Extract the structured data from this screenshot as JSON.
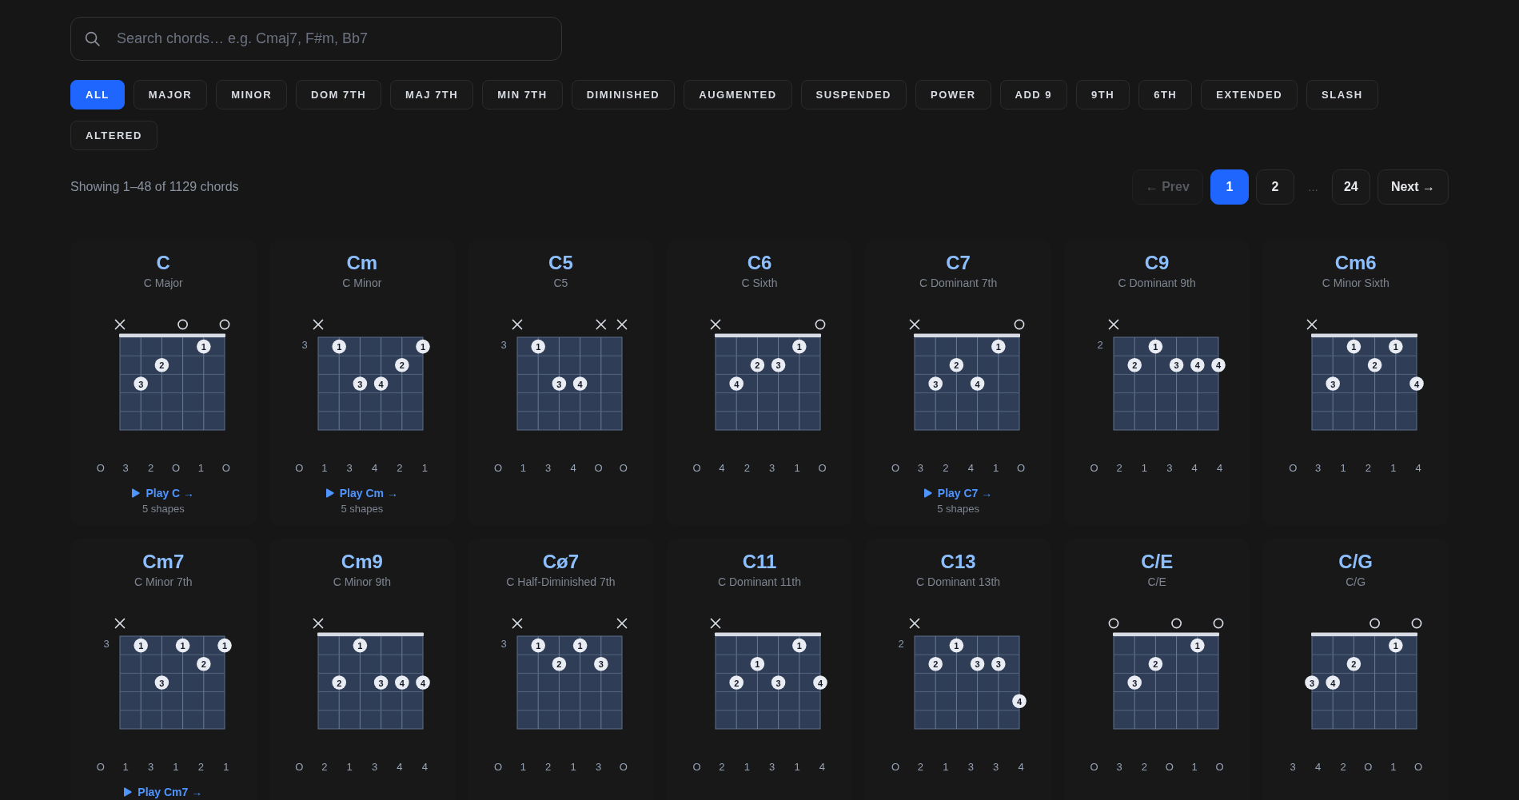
{
  "search": {
    "placeholder": "Search chords… e.g. Cmaj7, F#m, Bb7"
  },
  "filters": [
    {
      "label": "ALL",
      "selected": true
    },
    {
      "label": "MAJOR",
      "selected": false
    },
    {
      "label": "MINOR",
      "selected": false
    },
    {
      "label": "DOM 7TH",
      "selected": false
    },
    {
      "label": "MAJ 7TH",
      "selected": false
    },
    {
      "label": "MIN 7TH",
      "selected": false
    },
    {
      "label": "DIMINISHED",
      "selected": false
    },
    {
      "label": "AUGMENTED",
      "selected": false
    },
    {
      "label": "SUSPENDED",
      "selected": false
    },
    {
      "label": "POWER",
      "selected": false
    },
    {
      "label": "ADD 9",
      "selected": false
    },
    {
      "label": "9TH",
      "selected": false
    },
    {
      "label": "6TH",
      "selected": false
    },
    {
      "label": "EXTENDED",
      "selected": false
    },
    {
      "label": "SLASH",
      "selected": false
    },
    {
      "label": "ALTERED",
      "selected": false
    }
  ],
  "results_summary": "Showing 1–48 of 1129 chords",
  "pagination": {
    "prev": {
      "label": "← Prev",
      "disabled": true
    },
    "pages": [
      {
        "kind": "page",
        "label": "1",
        "selected": true
      },
      {
        "kind": "page",
        "label": "2",
        "selected": false
      },
      {
        "kind": "ellipsis",
        "label": "…",
        "selected": false
      },
      {
        "kind": "page",
        "label": "24",
        "selected": false
      }
    ],
    "next": {
      "label": "Next →",
      "disabled": false
    }
  },
  "chords": [
    {
      "name": "C",
      "full_name": "C Major",
      "markers": [
        {
          "kind": "muted"
        },
        {
          "kind": "none"
        },
        {
          "kind": "none"
        },
        {
          "kind": "open"
        },
        {
          "kind": "none"
        },
        {
          "kind": "open"
        }
      ],
      "nut": true,
      "fret_rows": [
        [
          {
            "kind": "empty"
          },
          {
            "kind": "empty"
          },
          {
            "kind": "empty"
          },
          {
            "kind": "empty"
          },
          {
            "kind": "dot",
            "finger": "1"
          },
          {
            "kind": "empty"
          }
        ],
        [
          {
            "kind": "empty"
          },
          {
            "kind": "empty"
          },
          {
            "kind": "dot",
            "finger": "2"
          },
          {
            "kind": "empty"
          },
          {
            "kind": "empty"
          },
          {
            "kind": "empty"
          }
        ],
        [
          {
            "kind": "empty"
          },
          {
            "kind": "dot",
            "finger": "3"
          },
          {
            "kind": "empty"
          },
          {
            "kind": "empty"
          },
          {
            "kind": "empty"
          },
          {
            "kind": "empty"
          }
        ],
        [
          {
            "kind": "empty"
          },
          {
            "kind": "empty"
          },
          {
            "kind": "empty"
          },
          {
            "kind": "empty"
          },
          {
            "kind": "empty"
          },
          {
            "kind": "empty"
          }
        ],
        [
          {
            "kind": "empty"
          },
          {
            "kind": "empty"
          },
          {
            "kind": "empty"
          },
          {
            "kind": "empty"
          },
          {
            "kind": "empty"
          },
          {
            "kind": "empty"
          }
        ]
      ],
      "fingers": [
        "O",
        "3",
        "2",
        "O",
        "1",
        "O"
      ],
      "play_link": "Play C →",
      "shapes": "5 shapes"
    },
    {
      "name": "Cm",
      "full_name": "C Minor",
      "markers": [
        {
          "kind": "muted"
        },
        {
          "kind": "none"
        },
        {
          "kind": "none"
        },
        {
          "kind": "none"
        },
        {
          "kind": "none"
        },
        {
          "kind": "none"
        }
      ],
      "nut": false,
      "base_fret": "3",
      "fret_rows": [
        [
          {
            "kind": "empty"
          },
          {
            "kind": "dot",
            "finger": "1"
          },
          {
            "kind": "empty"
          },
          {
            "kind": "empty"
          },
          {
            "kind": "empty"
          },
          {
            "kind": "dot",
            "finger": "1"
          }
        ],
        [
          {
            "kind": "empty"
          },
          {
            "kind": "empty"
          },
          {
            "kind": "empty"
          },
          {
            "kind": "empty"
          },
          {
            "kind": "dot",
            "finger": "2"
          },
          {
            "kind": "empty"
          }
        ],
        [
          {
            "kind": "empty"
          },
          {
            "kind": "empty"
          },
          {
            "kind": "dot",
            "finger": "3"
          },
          {
            "kind": "dot",
            "finger": "4"
          },
          {
            "kind": "empty"
          },
          {
            "kind": "empty"
          }
        ],
        [
          {
            "kind": "empty"
          },
          {
            "kind": "empty"
          },
          {
            "kind": "empty"
          },
          {
            "kind": "empty"
          },
          {
            "kind": "empty"
          },
          {
            "kind": "empty"
          }
        ],
        [
          {
            "kind": "empty"
          },
          {
            "kind": "empty"
          },
          {
            "kind": "empty"
          },
          {
            "kind": "empty"
          },
          {
            "kind": "empty"
          },
          {
            "kind": "empty"
          }
        ]
      ],
      "fingers": [
        "O",
        "1",
        "3",
        "4",
        "2",
        "1"
      ],
      "play_link": "Play Cm →",
      "shapes": "5 shapes"
    },
    {
      "name": "C5",
      "full_name": "C5",
      "markers": [
        {
          "kind": "muted"
        },
        {
          "kind": "none"
        },
        {
          "kind": "none"
        },
        {
          "kind": "none"
        },
        {
          "kind": "muted"
        },
        {
          "kind": "muted"
        }
      ],
      "nut": false,
      "base_fret": "3",
      "fret_rows": [
        [
          {
            "kind": "empty"
          },
          {
            "kind": "dot",
            "finger": "1"
          },
          {
            "kind": "empty"
          },
          {
            "kind": "empty"
          },
          {
            "kind": "empty"
          },
          {
            "kind": "empty"
          }
        ],
        [
          {
            "kind": "empty"
          },
          {
            "kind": "empty"
          },
          {
            "kind": "empty"
          },
          {
            "kind": "empty"
          },
          {
            "kind": "empty"
          },
          {
            "kind": "empty"
          }
        ],
        [
          {
            "kind": "empty"
          },
          {
            "kind": "empty"
          },
          {
            "kind": "dot",
            "finger": "3"
          },
          {
            "kind": "dot",
            "finger": "4"
          },
          {
            "kind": "empty"
          },
          {
            "kind": "empty"
          }
        ],
        [
          {
            "kind": "empty"
          },
          {
            "kind": "empty"
          },
          {
            "kind": "empty"
          },
          {
            "kind": "empty"
          },
          {
            "kind": "empty"
          },
          {
            "kind": "empty"
          }
        ],
        [
          {
            "kind": "empty"
          },
          {
            "kind": "empty"
          },
          {
            "kind": "empty"
          },
          {
            "kind": "empty"
          },
          {
            "kind": "empty"
          },
          {
            "kind": "empty"
          }
        ]
      ],
      "fingers": [
        "O",
        "1",
        "3",
        "4",
        "O",
        "O"
      ]
    },
    {
      "name": "C6",
      "full_name": "C Sixth",
      "markers": [
        {
          "kind": "muted"
        },
        {
          "kind": "none"
        },
        {
          "kind": "none"
        },
        {
          "kind": "none"
        },
        {
          "kind": "none"
        },
        {
          "kind": "open"
        }
      ],
      "nut": true,
      "fret_rows": [
        [
          {
            "kind": "empty"
          },
          {
            "kind": "empty"
          },
          {
            "kind": "empty"
          },
          {
            "kind": "empty"
          },
          {
            "kind": "dot",
            "finger": "1"
          },
          {
            "kind": "empty"
          }
        ],
        [
          {
            "kind": "empty"
          },
          {
            "kind": "empty"
          },
          {
            "kind": "dot",
            "finger": "2"
          },
          {
            "kind": "dot",
            "finger": "3"
          },
          {
            "kind": "empty"
          },
          {
            "kind": "empty"
          }
        ],
        [
          {
            "kind": "empty"
          },
          {
            "kind": "dot",
            "finger": "4"
          },
          {
            "kind": "empty"
          },
          {
            "kind": "empty"
          },
          {
            "kind": "empty"
          },
          {
            "kind": "empty"
          }
        ],
        [
          {
            "kind": "empty"
          },
          {
            "kind": "empty"
          },
          {
            "kind": "empty"
          },
          {
            "kind": "empty"
          },
          {
            "kind": "empty"
          },
          {
            "kind": "empty"
          }
        ],
        [
          {
            "kind": "empty"
          },
          {
            "kind": "empty"
          },
          {
            "kind": "empty"
          },
          {
            "kind": "empty"
          },
          {
            "kind": "empty"
          },
          {
            "kind": "empty"
          }
        ]
      ],
      "fingers": [
        "O",
        "4",
        "2",
        "3",
        "1",
        "O"
      ]
    },
    {
      "name": "C7",
      "full_name": "C Dominant 7th",
      "markers": [
        {
          "kind": "muted"
        },
        {
          "kind": "none"
        },
        {
          "kind": "none"
        },
        {
          "kind": "none"
        },
        {
          "kind": "none"
        },
        {
          "kind": "open"
        }
      ],
      "nut": true,
      "fret_rows": [
        [
          {
            "kind": "empty"
          },
          {
            "kind": "empty"
          },
          {
            "kind": "empty"
          },
          {
            "kind": "empty"
          },
          {
            "kind": "dot",
            "finger": "1"
          },
          {
            "kind": "empty"
          }
        ],
        [
          {
            "kind": "empty"
          },
          {
            "kind": "empty"
          },
          {
            "kind": "dot",
            "finger": "2"
          },
          {
            "kind": "empty"
          },
          {
            "kind": "empty"
          },
          {
            "kind": "empty"
          }
        ],
        [
          {
            "kind": "empty"
          },
          {
            "kind": "dot",
            "finger": "3"
          },
          {
            "kind": "empty"
          },
          {
            "kind": "dot",
            "finger": "4"
          },
          {
            "kind": "empty"
          },
          {
            "kind": "empty"
          }
        ],
        [
          {
            "kind": "empty"
          },
          {
            "kind": "empty"
          },
          {
            "kind": "empty"
          },
          {
            "kind": "empty"
          },
          {
            "kind": "empty"
          },
          {
            "kind": "empty"
          }
        ],
        [
          {
            "kind": "empty"
          },
          {
            "kind": "empty"
          },
          {
            "kind": "empty"
          },
          {
            "kind": "empty"
          },
          {
            "kind": "empty"
          },
          {
            "kind": "empty"
          }
        ]
      ],
      "fingers": [
        "O",
        "3",
        "2",
        "4",
        "1",
        "O"
      ],
      "play_link": "Play C7 →",
      "shapes": "5 shapes"
    },
    {
      "name": "C9",
      "full_name": "C Dominant 9th",
      "markers": [
        {
          "kind": "muted"
        },
        {
          "kind": "none"
        },
        {
          "kind": "none"
        },
        {
          "kind": "none"
        },
        {
          "kind": "none"
        },
        {
          "kind": "none"
        }
      ],
      "nut": false,
      "base_fret": "2",
      "fret_rows": [
        [
          {
            "kind": "empty"
          },
          {
            "kind": "empty"
          },
          {
            "kind": "dot",
            "finger": "1"
          },
          {
            "kind": "empty"
          },
          {
            "kind": "empty"
          },
          {
            "kind": "empty"
          }
        ],
        [
          {
            "kind": "empty"
          },
          {
            "kind": "dot",
            "finger": "2"
          },
          {
            "kind": "empty"
          },
          {
            "kind": "dot",
            "finger": "3"
          },
          {
            "kind": "dot",
            "finger": "4"
          },
          {
            "kind": "dot",
            "finger": "4"
          }
        ],
        [
          {
            "kind": "empty"
          },
          {
            "kind": "empty"
          },
          {
            "kind": "empty"
          },
          {
            "kind": "empty"
          },
          {
            "kind": "empty"
          },
          {
            "kind": "empty"
          }
        ],
        [
          {
            "kind": "empty"
          },
          {
            "kind": "empty"
          },
          {
            "kind": "empty"
          },
          {
            "kind": "empty"
          },
          {
            "kind": "empty"
          },
          {
            "kind": "empty"
          }
        ],
        [
          {
            "kind": "empty"
          },
          {
            "kind": "empty"
          },
          {
            "kind": "empty"
          },
          {
            "kind": "empty"
          },
          {
            "kind": "empty"
          },
          {
            "kind": "empty"
          }
        ]
      ],
      "fingers": [
        "O",
        "2",
        "1",
        "3",
        "4",
        "4"
      ]
    },
    {
      "name": "Cm6",
      "full_name": "C Minor Sixth",
      "markers": [
        {
          "kind": "muted"
        },
        {
          "kind": "none"
        },
        {
          "kind": "none"
        },
        {
          "kind": "none"
        },
        {
          "kind": "none"
        },
        {
          "kind": "none"
        }
      ],
      "nut": true,
      "fret_rows": [
        [
          {
            "kind": "empty"
          },
          {
            "kind": "empty"
          },
          {
            "kind": "dot",
            "finger": "1"
          },
          {
            "kind": "empty"
          },
          {
            "kind": "dot",
            "finger": "1"
          },
          {
            "kind": "empty"
          }
        ],
        [
          {
            "kind": "empty"
          },
          {
            "kind": "empty"
          },
          {
            "kind": "empty"
          },
          {
            "kind": "dot",
            "finger": "2"
          },
          {
            "kind": "empty"
          },
          {
            "kind": "empty"
          }
        ],
        [
          {
            "kind": "empty"
          },
          {
            "kind": "dot",
            "finger": "3"
          },
          {
            "kind": "empty"
          },
          {
            "kind": "empty"
          },
          {
            "kind": "empty"
          },
          {
            "kind": "dot",
            "finger": "4"
          }
        ],
        [
          {
            "kind": "empty"
          },
          {
            "kind": "empty"
          },
          {
            "kind": "empty"
          },
          {
            "kind": "empty"
          },
          {
            "kind": "empty"
          },
          {
            "kind": "empty"
          }
        ],
        [
          {
            "kind": "empty"
          },
          {
            "kind": "empty"
          },
          {
            "kind": "empty"
          },
          {
            "kind": "empty"
          },
          {
            "kind": "empty"
          },
          {
            "kind": "empty"
          }
        ]
      ],
      "fingers": [
        "O",
        "3",
        "1",
        "2",
        "1",
        "4"
      ]
    },
    {
      "name": "Cm7",
      "full_name": "C Minor 7th",
      "markers": [
        {
          "kind": "muted"
        },
        {
          "kind": "none"
        },
        {
          "kind": "none"
        },
        {
          "kind": "none"
        },
        {
          "kind": "none"
        },
        {
          "kind": "none"
        }
      ],
      "nut": false,
      "base_fret": "3",
      "fret_rows": [
        [
          {
            "kind": "empty"
          },
          {
            "kind": "dot",
            "finger": "1"
          },
          {
            "kind": "empty"
          },
          {
            "kind": "dot",
            "finger": "1"
          },
          {
            "kind": "empty"
          },
          {
            "kind": "dot",
            "finger": "1"
          }
        ],
        [
          {
            "kind": "empty"
          },
          {
            "kind": "empty"
          },
          {
            "kind": "empty"
          },
          {
            "kind": "empty"
          },
          {
            "kind": "dot",
            "finger": "2"
          },
          {
            "kind": "empty"
          }
        ],
        [
          {
            "kind": "empty"
          },
          {
            "kind": "empty"
          },
          {
            "kind": "dot",
            "finger": "3"
          },
          {
            "kind": "empty"
          },
          {
            "kind": "empty"
          },
          {
            "kind": "empty"
          }
        ],
        [
          {
            "kind": "empty"
          },
          {
            "kind": "empty"
          },
          {
            "kind": "empty"
          },
          {
            "kind": "empty"
          },
          {
            "kind": "empty"
          },
          {
            "kind": "empty"
          }
        ],
        [
          {
            "kind": "empty"
          },
          {
            "kind": "empty"
          },
          {
            "kind": "empty"
          },
          {
            "kind": "empty"
          },
          {
            "kind": "empty"
          },
          {
            "kind": "empty"
          }
        ]
      ],
      "fingers": [
        "O",
        "1",
        "3",
        "1",
        "2",
        "1"
      ],
      "play_link": "Play Cm7 →"
    },
    {
      "name": "Cm9",
      "full_name": "C Minor 9th",
      "markers": [
        {
          "kind": "muted"
        },
        {
          "kind": "none"
        },
        {
          "kind": "none"
        },
        {
          "kind": "none"
        },
        {
          "kind": "none"
        },
        {
          "kind": "none"
        }
      ],
      "nut": true,
      "fret_rows": [
        [
          {
            "kind": "empty"
          },
          {
            "kind": "empty"
          },
          {
            "kind": "dot",
            "finger": "1"
          },
          {
            "kind": "empty"
          },
          {
            "kind": "empty"
          },
          {
            "kind": "empty"
          }
        ],
        [
          {
            "kind": "empty"
          },
          {
            "kind": "empty"
          },
          {
            "kind": "empty"
          },
          {
            "kind": "empty"
          },
          {
            "kind": "empty"
          },
          {
            "kind": "empty"
          }
        ],
        [
          {
            "kind": "empty"
          },
          {
            "kind": "dot",
            "finger": "2"
          },
          {
            "kind": "empty"
          },
          {
            "kind": "dot",
            "finger": "3"
          },
          {
            "kind": "dot",
            "finger": "4"
          },
          {
            "kind": "dot",
            "finger": "4"
          }
        ],
        [
          {
            "kind": "empty"
          },
          {
            "kind": "empty"
          },
          {
            "kind": "empty"
          },
          {
            "kind": "empty"
          },
          {
            "kind": "empty"
          },
          {
            "kind": "empty"
          }
        ],
        [
          {
            "kind": "empty"
          },
          {
            "kind": "empty"
          },
          {
            "kind": "empty"
          },
          {
            "kind": "empty"
          },
          {
            "kind": "empty"
          },
          {
            "kind": "empty"
          }
        ]
      ],
      "fingers": [
        "O",
        "2",
        "1",
        "3",
        "4",
        "4"
      ]
    },
    {
      "name": "Cø7",
      "full_name": "C Half-Diminished 7th",
      "markers": [
        {
          "kind": "muted"
        },
        {
          "kind": "none"
        },
        {
          "kind": "none"
        },
        {
          "kind": "none"
        },
        {
          "kind": "none"
        },
        {
          "kind": "muted"
        }
      ],
      "nut": false,
      "base_fret": "3",
      "fret_rows": [
        [
          {
            "kind": "empty"
          },
          {
            "kind": "dot",
            "finger": "1"
          },
          {
            "kind": "empty"
          },
          {
            "kind": "dot",
            "finger": "1"
          },
          {
            "kind": "empty"
          },
          {
            "kind": "empty"
          }
        ],
        [
          {
            "kind": "empty"
          },
          {
            "kind": "empty"
          },
          {
            "kind": "dot",
            "finger": "2"
          },
          {
            "kind": "empty"
          },
          {
            "kind": "dot",
            "finger": "3"
          },
          {
            "kind": "empty"
          }
        ],
        [
          {
            "kind": "empty"
          },
          {
            "kind": "empty"
          },
          {
            "kind": "empty"
          },
          {
            "kind": "empty"
          },
          {
            "kind": "empty"
          },
          {
            "kind": "empty"
          }
        ],
        [
          {
            "kind": "empty"
          },
          {
            "kind": "empty"
          },
          {
            "kind": "empty"
          },
          {
            "kind": "empty"
          },
          {
            "kind": "empty"
          },
          {
            "kind": "empty"
          }
        ],
        [
          {
            "kind": "empty"
          },
          {
            "kind": "empty"
          },
          {
            "kind": "empty"
          },
          {
            "kind": "empty"
          },
          {
            "kind": "empty"
          },
          {
            "kind": "empty"
          }
        ]
      ],
      "fingers": [
        "O",
        "1",
        "2",
        "1",
        "3",
        "O"
      ]
    },
    {
      "name": "C11",
      "full_name": "C Dominant 11th",
      "markers": [
        {
          "kind": "muted"
        },
        {
          "kind": "none"
        },
        {
          "kind": "none"
        },
        {
          "kind": "none"
        },
        {
          "kind": "none"
        },
        {
          "kind": "none"
        }
      ],
      "nut": true,
      "fret_rows": [
        [
          {
            "kind": "empty"
          },
          {
            "kind": "empty"
          },
          {
            "kind": "empty"
          },
          {
            "kind": "empty"
          },
          {
            "kind": "dot",
            "finger": "1"
          },
          {
            "kind": "empty"
          }
        ],
        [
          {
            "kind": "empty"
          },
          {
            "kind": "empty"
          },
          {
            "kind": "dot",
            "finger": "1"
          },
          {
            "kind": "empty"
          },
          {
            "kind": "empty"
          },
          {
            "kind": "empty"
          }
        ],
        [
          {
            "kind": "empty"
          },
          {
            "kind": "dot",
            "finger": "2"
          },
          {
            "kind": "empty"
          },
          {
            "kind": "dot",
            "finger": "3"
          },
          {
            "kind": "empty"
          },
          {
            "kind": "dot",
            "finger": "4"
          }
        ],
        [
          {
            "kind": "empty"
          },
          {
            "kind": "empty"
          },
          {
            "kind": "empty"
          },
          {
            "kind": "empty"
          },
          {
            "kind": "empty"
          },
          {
            "kind": "empty"
          }
        ],
        [
          {
            "kind": "empty"
          },
          {
            "kind": "empty"
          },
          {
            "kind": "empty"
          },
          {
            "kind": "empty"
          },
          {
            "kind": "empty"
          },
          {
            "kind": "empty"
          }
        ]
      ],
      "fingers": [
        "O",
        "2",
        "1",
        "3",
        "1",
        "4"
      ]
    },
    {
      "name": "C13",
      "full_name": "C Dominant 13th",
      "markers": [
        {
          "kind": "muted"
        },
        {
          "kind": "none"
        },
        {
          "kind": "none"
        },
        {
          "kind": "none"
        },
        {
          "kind": "none"
        },
        {
          "kind": "none"
        }
      ],
      "nut": false,
      "base_fret": "2",
      "fret_rows": [
        [
          {
            "kind": "empty"
          },
          {
            "kind": "empty"
          },
          {
            "kind": "dot",
            "finger": "1"
          },
          {
            "kind": "empty"
          },
          {
            "kind": "empty"
          },
          {
            "kind": "empty"
          }
        ],
        [
          {
            "kind": "empty"
          },
          {
            "kind": "dot",
            "finger": "2"
          },
          {
            "kind": "empty"
          },
          {
            "kind": "dot",
            "finger": "3"
          },
          {
            "kind": "dot",
            "finger": "3"
          },
          {
            "kind": "empty"
          }
        ],
        [
          {
            "kind": "empty"
          },
          {
            "kind": "empty"
          },
          {
            "kind": "empty"
          },
          {
            "kind": "empty"
          },
          {
            "kind": "empty"
          },
          {
            "kind": "empty"
          }
        ],
        [
          {
            "kind": "empty"
          },
          {
            "kind": "empty"
          },
          {
            "kind": "empty"
          },
          {
            "kind": "empty"
          },
          {
            "kind": "empty"
          },
          {
            "kind": "dot",
            "finger": "4"
          }
        ],
        [
          {
            "kind": "empty"
          },
          {
            "kind": "empty"
          },
          {
            "kind": "empty"
          },
          {
            "kind": "empty"
          },
          {
            "kind": "empty"
          },
          {
            "kind": "empty"
          }
        ]
      ],
      "fingers": [
        "O",
        "2",
        "1",
        "3",
        "3",
        "4"
      ]
    },
    {
      "name": "C/E",
      "full_name": "C/E",
      "markers": [
        {
          "kind": "open"
        },
        {
          "kind": "none"
        },
        {
          "kind": "none"
        },
        {
          "kind": "open"
        },
        {
          "kind": "none"
        },
        {
          "kind": "open"
        }
      ],
      "nut": true,
      "fret_rows": [
        [
          {
            "kind": "empty"
          },
          {
            "kind": "empty"
          },
          {
            "kind": "empty"
          },
          {
            "kind": "empty"
          },
          {
            "kind": "dot",
            "finger": "1"
          },
          {
            "kind": "empty"
          }
        ],
        [
          {
            "kind": "empty"
          },
          {
            "kind": "empty"
          },
          {
            "kind": "dot",
            "finger": "2"
          },
          {
            "kind": "empty"
          },
          {
            "kind": "empty"
          },
          {
            "kind": "empty"
          }
        ],
        [
          {
            "kind": "empty"
          },
          {
            "kind": "dot",
            "finger": "3"
          },
          {
            "kind": "empty"
          },
          {
            "kind": "empty"
          },
          {
            "kind": "empty"
          },
          {
            "kind": "empty"
          }
        ],
        [
          {
            "kind": "empty"
          },
          {
            "kind": "empty"
          },
          {
            "kind": "empty"
          },
          {
            "kind": "empty"
          },
          {
            "kind": "empty"
          },
          {
            "kind": "empty"
          }
        ],
        [
          {
            "kind": "empty"
          },
          {
            "kind": "empty"
          },
          {
            "kind": "empty"
          },
          {
            "kind": "empty"
          },
          {
            "kind": "empty"
          },
          {
            "kind": "empty"
          }
        ]
      ],
      "fingers": [
        "O",
        "3",
        "2",
        "O",
        "1",
        "O"
      ]
    },
    {
      "name": "C/G",
      "full_name": "C/G",
      "markers": [
        {
          "kind": "none"
        },
        {
          "kind": "none"
        },
        {
          "kind": "none"
        },
        {
          "kind": "open"
        },
        {
          "kind": "none"
        },
        {
          "kind": "open"
        }
      ],
      "nut": true,
      "fret_rows": [
        [
          {
            "kind": "empty"
          },
          {
            "kind": "empty"
          },
          {
            "kind": "empty"
          },
          {
            "kind": "empty"
          },
          {
            "kind": "dot",
            "finger": "1"
          },
          {
            "kind": "empty"
          }
        ],
        [
          {
            "kind": "empty"
          },
          {
            "kind": "empty"
          },
          {
            "kind": "dot",
            "finger": "2"
          },
          {
            "kind": "empty"
          },
          {
            "kind": "empty"
          },
          {
            "kind": "empty"
          }
        ],
        [
          {
            "kind": "dot",
            "finger": "3"
          },
          {
            "kind": "dot",
            "finger": "4"
          },
          {
            "kind": "empty"
          },
          {
            "kind": "empty"
          },
          {
            "kind": "empty"
          },
          {
            "kind": "empty"
          }
        ],
        [
          {
            "kind": "empty"
          },
          {
            "kind": "empty"
          },
          {
            "kind": "empty"
          },
          {
            "kind": "empty"
          },
          {
            "kind": "empty"
          },
          {
            "kind": "empty"
          }
        ],
        [
          {
            "kind": "empty"
          },
          {
            "kind": "empty"
          },
          {
            "kind": "empty"
          },
          {
            "kind": "empty"
          },
          {
            "kind": "empty"
          },
          {
            "kind": "empty"
          }
        ]
      ],
      "fingers": [
        "3",
        "4",
        "2",
        "O",
        "1",
        "O"
      ]
    }
  ]
}
